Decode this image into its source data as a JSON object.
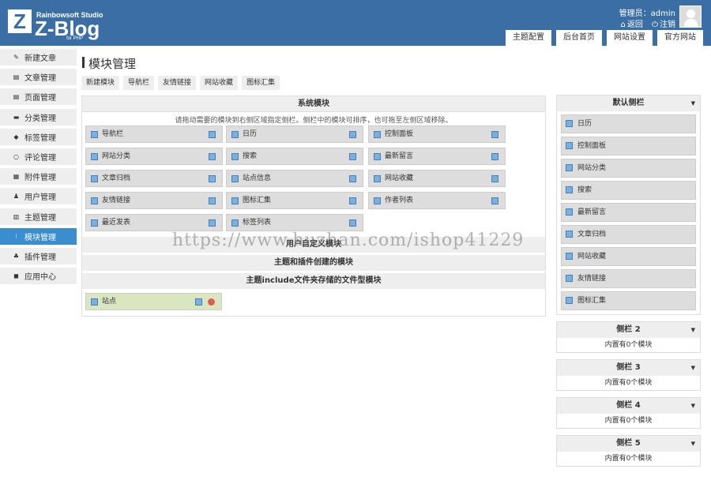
{
  "header": {
    "logo_letter": "Z",
    "studio": "Rainbowsoft Studio",
    "brand": "Z-Blog",
    "forphp": "for PHP",
    "user_label": "管理员：admin",
    "back": "返回",
    "logout": "注销",
    "tabs": [
      "主题配置",
      "后台首页",
      "网站设置",
      "官方网站"
    ]
  },
  "sidebar": {
    "items": [
      "新建文章",
      "文章管理",
      "页面管理",
      "分类管理",
      "标签管理",
      "评论管理",
      "附件管理",
      "用户管理",
      "主题管理",
      "模块管理",
      "插件管理",
      "应用中心"
    ]
  },
  "page": {
    "title": "模块管理",
    "subtabs": [
      "新建模块",
      "导航栏",
      "友情链接",
      "网站收藏",
      "图标汇集"
    ]
  },
  "main": {
    "system_title": "系统模块",
    "hint": "请拖动需要的模块到右侧区域指定侧栏。侧栏中的模块可排序，也可拖至左侧区域移除。",
    "modules": [
      "导航栏",
      "日历",
      "控制面板",
      "网站分类",
      "搜索",
      "最新留言",
      "文章归档",
      "站点信息",
      "网站收藏",
      "友情链接",
      "图标汇集",
      "作者列表",
      "最近发表",
      "标签列表"
    ],
    "user_defined": "用户自定义模块",
    "theme_plugin": "主题和插件创建的模块",
    "theme_include": "主题include文件夹存储的文件型模块",
    "site_module": "站点"
  },
  "right": {
    "default_title": "默认侧栏",
    "default_items": [
      "日历",
      "控制面板",
      "网站分类",
      "搜索",
      "最新留言",
      "文章归档",
      "网站收藏",
      "友情链接",
      "图标汇集"
    ],
    "sidebar2": "侧栏 2",
    "sidebar3": "侧栏 3",
    "sidebar4": "侧栏 4",
    "sidebar5": "侧栏 5",
    "empty": "内置有0个模块"
  },
  "watermark": "https://www.huzhan.com/ishop41229"
}
